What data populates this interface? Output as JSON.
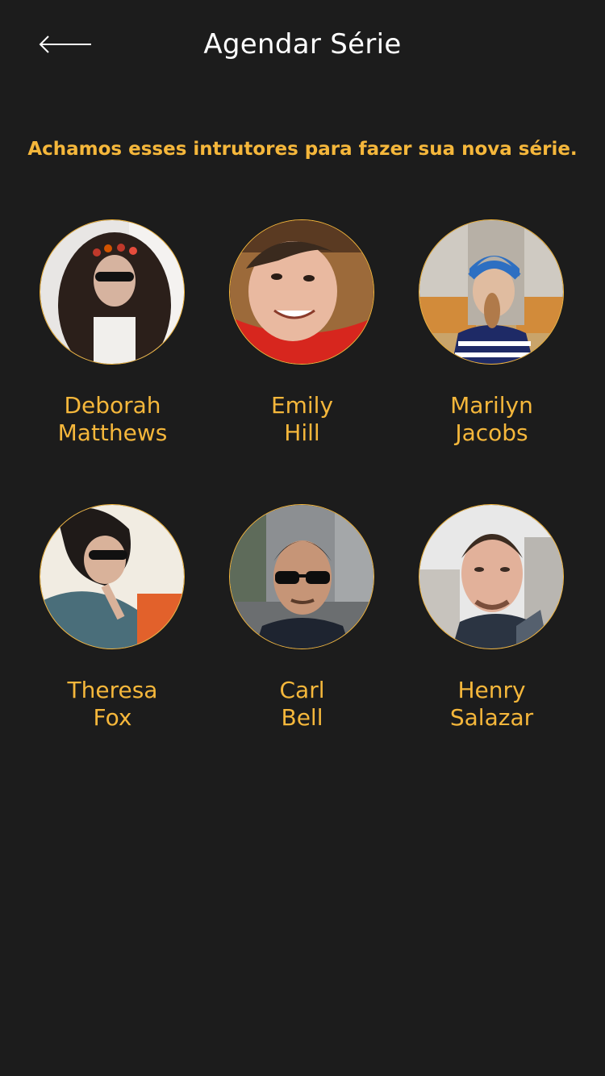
{
  "header": {
    "title": "Agendar Série",
    "back_icon": "arrow-left-icon"
  },
  "subtitle": "Achamos esses intrutores para fazer sua nova série.",
  "colors": {
    "background": "#1c1c1c",
    "accent": "#f5b73b",
    "title": "#ffffff"
  },
  "instructors": [
    {
      "first": "Deborah",
      "last": "Matthews"
    },
    {
      "first": "Emily",
      "last": "Hill"
    },
    {
      "first": "Marilyn",
      "last": "Jacobs"
    },
    {
      "first": "Theresa",
      "last": "Fox"
    },
    {
      "first": "Carl",
      "last": "Bell"
    },
    {
      "first": "Henry",
      "last": "Salazar"
    }
  ]
}
